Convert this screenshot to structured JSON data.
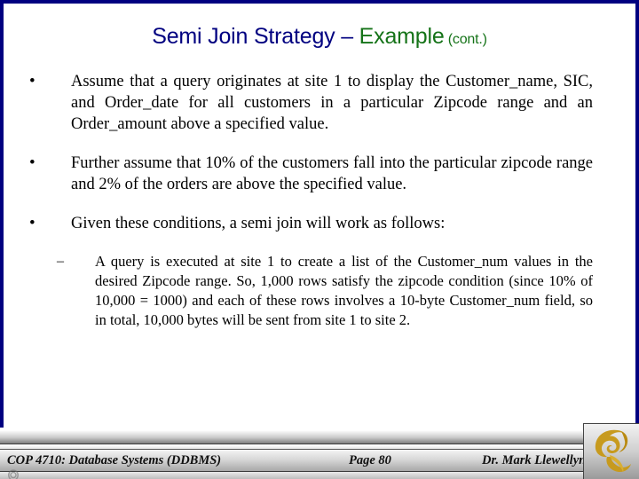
{
  "slide": {
    "title": {
      "main": "Semi Join Strategy – ",
      "accent": "Example",
      "cont": " (cont.)"
    },
    "bullets": [
      {
        "marker": "•",
        "text": "Assume that a query originates at site 1 to display the Customer_name, SIC, and Order_date for all customers in a particular Zipcode range and an Order_amount above a specified value."
      },
      {
        "marker": "•",
        "text": "Further assume that 10% of the customers fall into the particular zipcode range and 2% of the orders are above the specified value."
      },
      {
        "marker": "•",
        "text": "Given these conditions, a semi join will work as follows:"
      }
    ],
    "sub_bullets": [
      {
        "marker": "–",
        "text": "A query is executed at site 1 to create a list of the Customer_num values in the desired Zipcode range.  So, 1,000 rows satisfy the zipcode condition (since 10% of 10,000 = 1000) and each of these rows involves a 10-byte Customer_num field, so in total, 10,000 bytes will be sent from site 1 to site 2."
      }
    ],
    "footer": {
      "course": "COP 4710: Database Systems  (DDBMS)",
      "page": "Page 80",
      "author": "Dr. Mark Llewellyn"
    },
    "colors": {
      "title_main": "#000080",
      "title_accent": "#157318",
      "border": "#000080",
      "logo_gold": "#C79A1E",
      "body_text": "#000000"
    }
  }
}
